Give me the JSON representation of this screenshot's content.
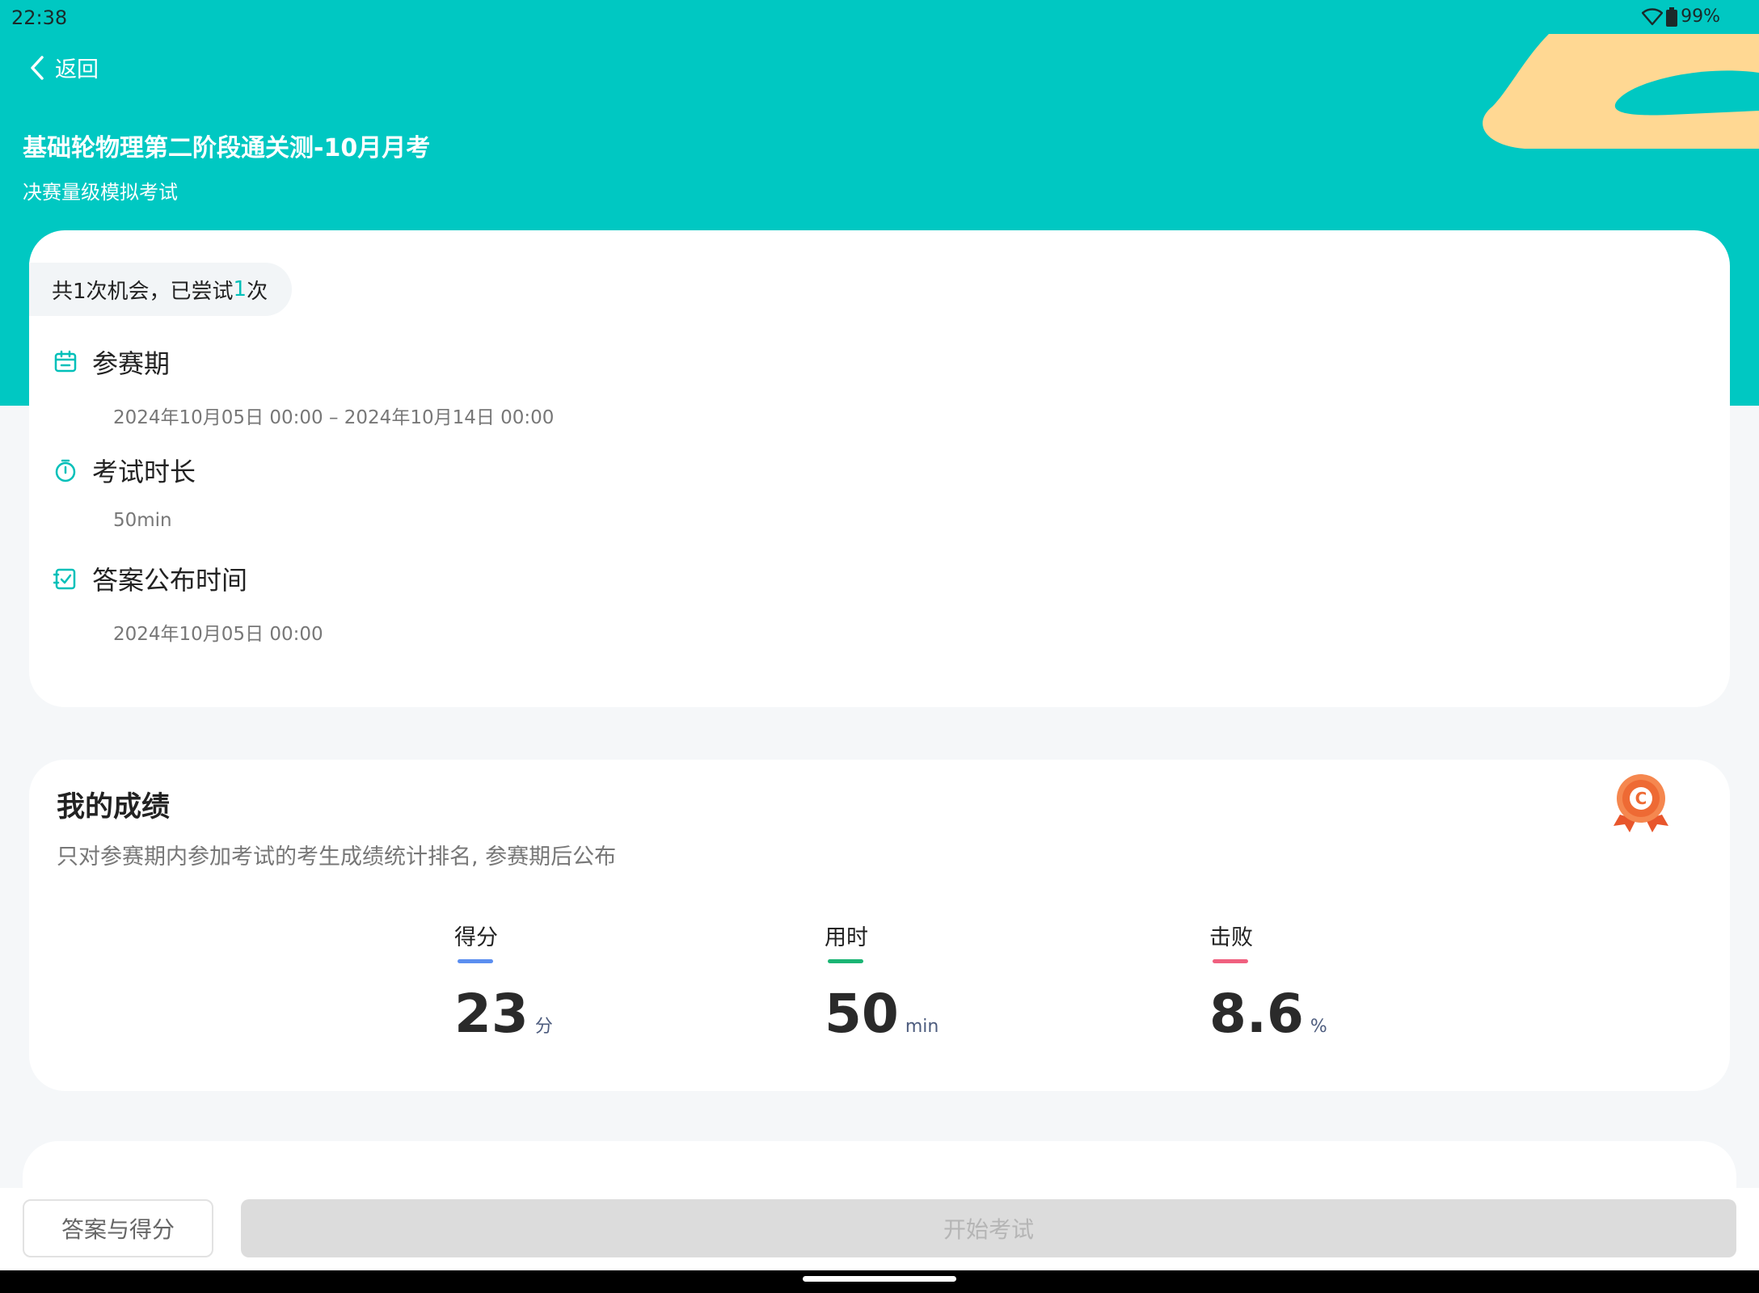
{
  "status_bar": {
    "time": "22:38",
    "battery": "99%"
  },
  "header": {
    "back_label": "返回",
    "title": "基础轮物理第二阶段通关测-10月月考",
    "subtitle": "决赛量级模拟考试"
  },
  "info": {
    "attempt_prefix": "共1次机会，已尝试",
    "attempt_count": "1",
    "attempt_suffix": "次",
    "period_label": "参赛期",
    "period_value": "2024年10月05日 00:00  –  2024年10月14日 00:00",
    "duration_label": "考试时长",
    "duration_value": "50min",
    "answer_label": "答案公布时间",
    "answer_value": "2024年10月05日 00:00"
  },
  "score": {
    "title": "我的成绩",
    "note": "只对参赛期内参加考试的考生成绩统计排名, 参赛期后公布",
    "medal_letter": "C",
    "stats": [
      {
        "label": "得分",
        "value": "23",
        "unit": "分",
        "color": "#5b8ef0"
      },
      {
        "label": "用时",
        "value": "50",
        "unit": "min",
        "color": "#1bb574"
      },
      {
        "label": "击败",
        "value": "8.6",
        "unit": "%",
        "color": "#f0607f"
      }
    ]
  },
  "actions": {
    "answer_button": "答案与得分",
    "start_button": "开始考试"
  },
  "colors": {
    "accent": "#00c8c2",
    "deco_sand": "#ffd893"
  }
}
